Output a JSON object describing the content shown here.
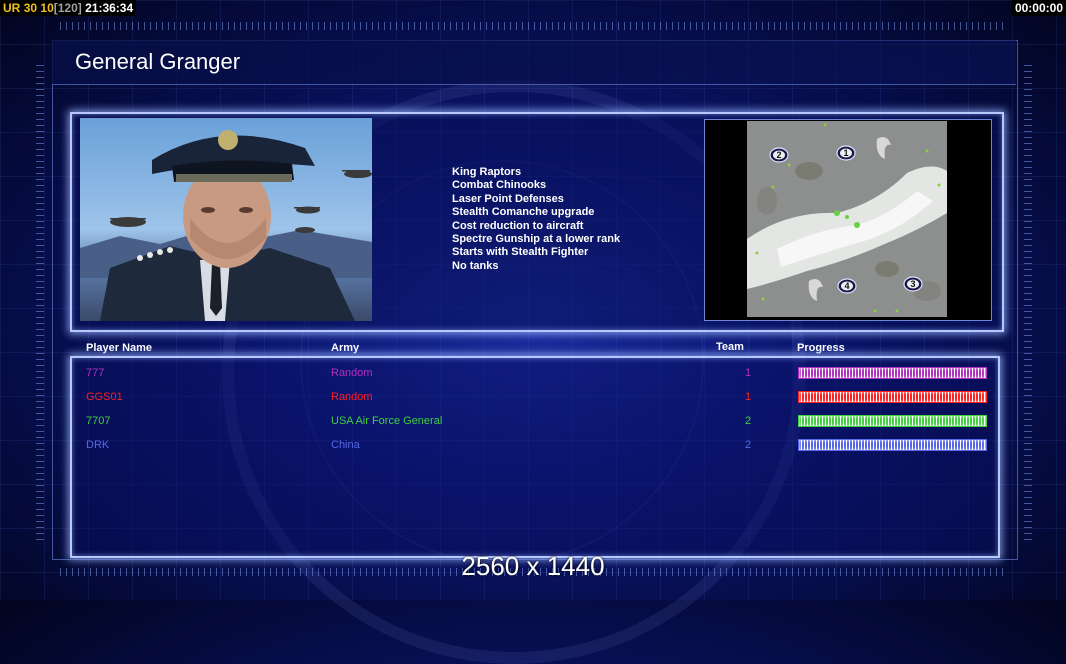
{
  "hud": {
    "ur_label": "UR",
    "ur_value": "30",
    "fps": "10",
    "fps_max": "[120]",
    "clock": "21:36:34",
    "timer": "00:00:00"
  },
  "title": "General Granger",
  "general": {
    "features": [
      "King Raptors",
      "Combat Chinooks",
      "Laser Point Defenses",
      "Stealth Comanche upgrade",
      "Cost reduction to aircraft",
      "Spectre Gunship at a lower rank",
      "Starts with Stealth Fighter",
      "No tanks"
    ]
  },
  "map": {
    "start_positions": [
      "1",
      "2",
      "3",
      "4"
    ]
  },
  "players_table": {
    "headers": {
      "name": "Player Name",
      "army": "Army",
      "team": "Team",
      "progress": "Progress"
    },
    "rows": [
      {
        "name": "777",
        "army": "Random",
        "team": "1",
        "color": "#b030c0",
        "progress": 1.0
      },
      {
        "name": "GGS01",
        "army": "Random",
        "team": "1",
        "color": "#ff2020",
        "progress": 1.0
      },
      {
        "name": "7707",
        "army": "USA Air Force General",
        "team": "2",
        "color": "#40d040",
        "progress": 1.0
      },
      {
        "name": "DRK",
        "army": "China",
        "team": "2",
        "color": "#5868e8",
        "progress": 1.0
      }
    ]
  },
  "resolution": "2560 x 1440",
  "colors": {
    "hud_yellow": "#f0c020",
    "hud_gray": "#a0a0a0",
    "panel_border": "#b8c8ff"
  }
}
